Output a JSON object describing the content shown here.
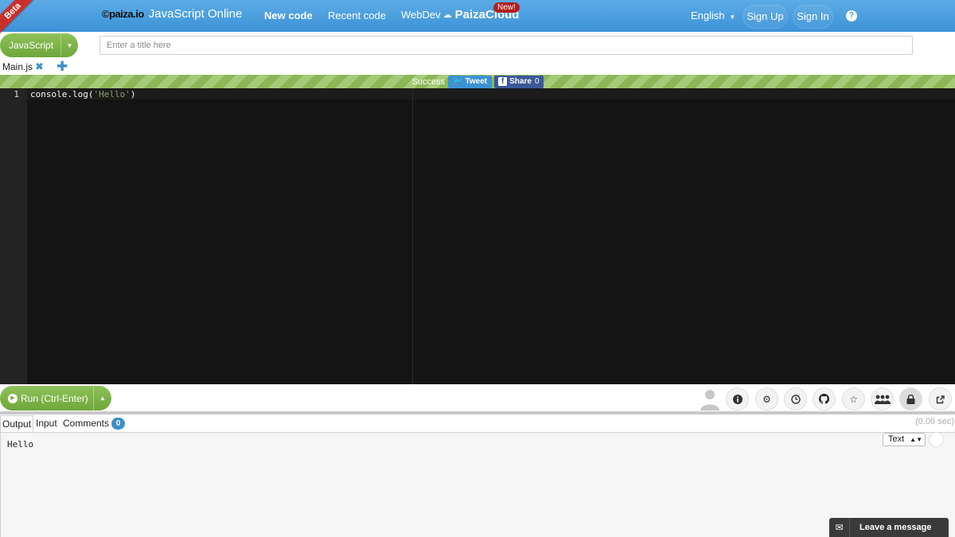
{
  "navbar": {
    "beta_label": "Beta",
    "logo_text": "©paiza.io",
    "app_title": "JavaScript Online",
    "new_code": "New code",
    "recent_code": "Recent code",
    "webdev": "WebDev",
    "paizacloud": "PaizaCloud",
    "new_badge": "New!",
    "language": "English",
    "sign_up": "Sign Up",
    "sign_in": "Sign In",
    "help": "?"
  },
  "toolbar": {
    "language_button": "JavaScript",
    "title_placeholder": "Enter a title here",
    "title_value": ""
  },
  "files": {
    "tabs": [
      {
        "label": "Main.js"
      }
    ],
    "close": "✖",
    "add": "✚"
  },
  "status": {
    "text": "Success",
    "tweet": "Tweet",
    "share": "Share",
    "share_count": "0",
    "color_success": "#8cb759"
  },
  "editor": {
    "line_numbers": [
      "1"
    ],
    "code": {
      "prefix": "console.log(",
      "string": "'Hello'",
      "suffix": ")"
    }
  },
  "run": {
    "label": "Run (Ctrl-Enter)",
    "tools": [
      {
        "icon": "info-icon"
      },
      {
        "icon": "gear-icon"
      },
      {
        "icon": "clock-icon"
      },
      {
        "icon": "github-icon"
      },
      {
        "icon": "star-icon"
      },
      {
        "icon": "group-icon"
      },
      {
        "icon": "lock-icon"
      },
      {
        "icon": "share-icon"
      }
    ]
  },
  "output": {
    "tabs": {
      "output": "Output",
      "input": "Input",
      "comments": "Comments",
      "comments_count": "0"
    },
    "exec_time": "(0.06 sec)",
    "text": "Hello",
    "format_select": "Text"
  },
  "message": {
    "label": "Leave a message"
  },
  "colors": {
    "nav_blue": "#4a9fdf",
    "green": "#7cb342",
    "editor_bg": "#141414"
  }
}
